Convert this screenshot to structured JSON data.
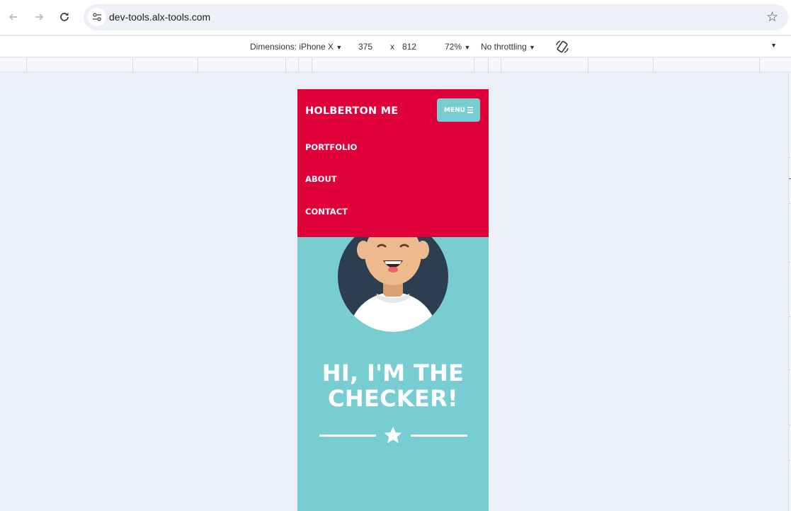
{
  "browser": {
    "url": "dev-tools.alx-tools.com",
    "back_icon": "arrow-left-icon",
    "forward_icon": "arrow-right-icon",
    "reload_icon": "reload-icon",
    "site_info_icon": "site-settings-icon",
    "bookmark_icon": "star-outline-icon"
  },
  "devtools": {
    "dimensions_label": "Dimensions: iPhone X",
    "width": "375",
    "times": "x",
    "height": "812",
    "zoom": "72%",
    "throttling": "No throttling",
    "caret": "▼"
  },
  "site": {
    "brand": "HOLBERTON ME",
    "menu_label": "MENU",
    "nav": [
      "PORTFOLIO",
      "ABOUT",
      "CONTACT"
    ],
    "hero_title_line1": "HI, I'M THE",
    "hero_title_line2": "CHECKER!",
    "colors": {
      "primary": "#e0003a",
      "secondary": "#78cdd3",
      "avatar_bg": "#2c3e50"
    }
  }
}
